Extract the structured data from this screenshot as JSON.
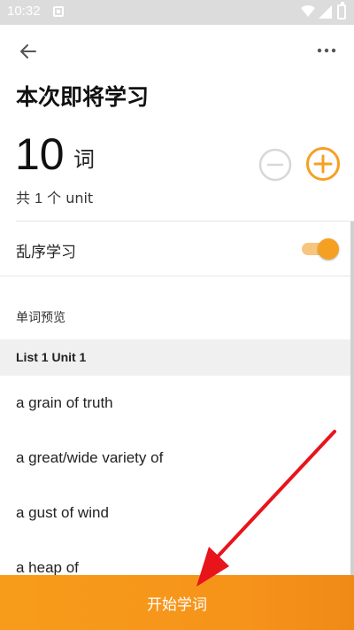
{
  "status_bar": {
    "time": "10:32",
    "icons": [
      "notification-icon",
      "wifi-icon",
      "signal-icon",
      "battery-icon"
    ]
  },
  "toolbar": {
    "back_icon": "arrow-left-icon",
    "more_icon": "more-horizontal-icon"
  },
  "header": {
    "title": "本次即将学习"
  },
  "word_count": {
    "value": "10",
    "unit": "词",
    "total_prefix": "共",
    "total_number": "1",
    "total_suffix": "个 unit"
  },
  "shuffle": {
    "label": "乱序学习",
    "enabled": true
  },
  "preview": {
    "label": "单词预览",
    "list_title": "List 1 Unit 1",
    "words": [
      "a grain of truth",
      "a great/wide variety of",
      "a gust of wind",
      "a heap of"
    ]
  },
  "action": {
    "start_label": "开始学词"
  },
  "colors": {
    "accent": "#F5A023",
    "annotation_arrow": "#E8141C"
  }
}
